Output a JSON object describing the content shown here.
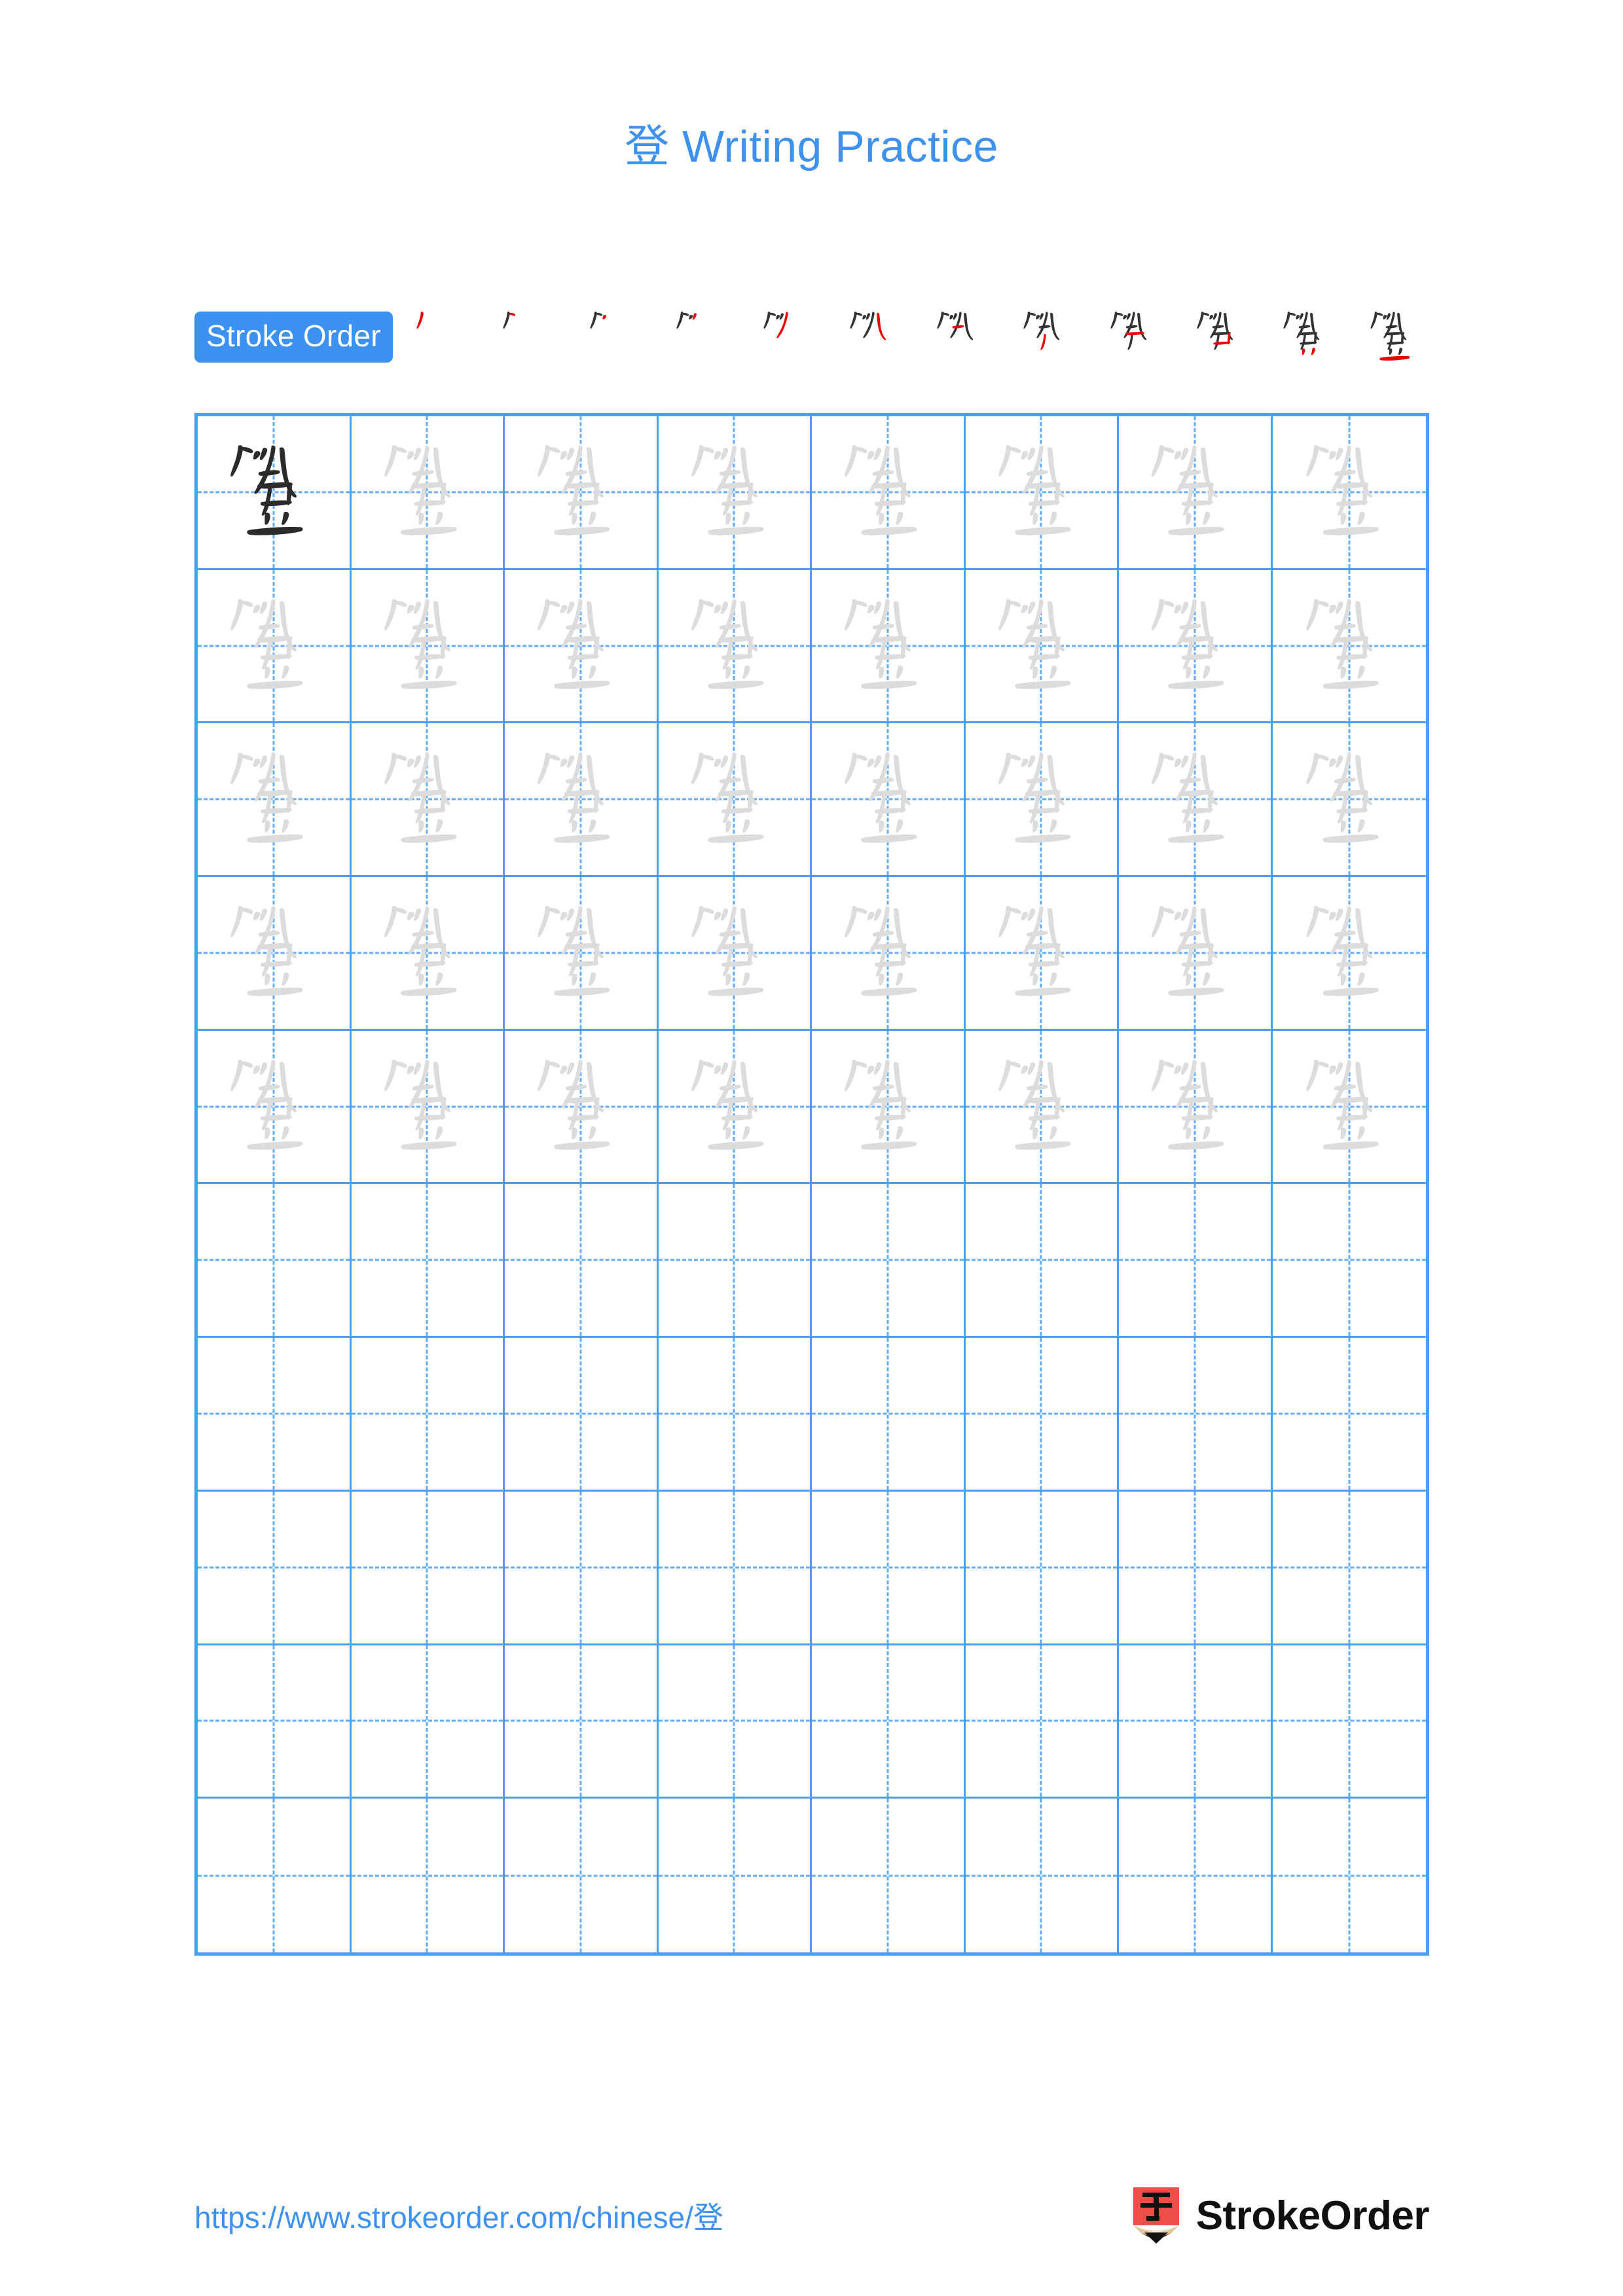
{
  "document": {
    "title_character": "登",
    "title_text": "Writing Practice",
    "title_full": "登 Writing Practice",
    "accent_color": "#3d91f0",
    "grid_line_color": "#4a9ff5",
    "guide_char_color": "#dcdcdc",
    "model_char_color": "#2b2b2b",
    "new_stroke_color": "#ee0000",
    "existing_stroke_color": "#333333"
  },
  "stroke_order": {
    "badge_label": "Stroke Order",
    "total_strokes": 12,
    "steps": [
      {
        "index": 1,
        "strokes_shown": 1
      },
      {
        "index": 2,
        "strokes_shown": 2
      },
      {
        "index": 3,
        "strokes_shown": 3
      },
      {
        "index": 4,
        "strokes_shown": 4
      },
      {
        "index": 5,
        "strokes_shown": 5
      },
      {
        "index": 6,
        "strokes_shown": 6
      },
      {
        "index": 7,
        "strokes_shown": 7
      },
      {
        "index": 8,
        "strokes_shown": 8
      },
      {
        "index": 9,
        "strokes_shown": 9
      },
      {
        "index": 10,
        "strokes_shown": 10
      },
      {
        "index": 11,
        "strokes_shown": 11
      },
      {
        "index": 12,
        "strokes_shown": 12
      }
    ]
  },
  "practice_grid": {
    "columns": 8,
    "rows": 10,
    "character": "登",
    "rows_with_characters": 5,
    "rows_empty": 5,
    "cells": [
      [
        "model",
        "guide",
        "guide",
        "guide",
        "guide",
        "guide",
        "guide",
        "guide"
      ],
      [
        "guide",
        "guide",
        "guide",
        "guide",
        "guide",
        "guide",
        "guide",
        "guide"
      ],
      [
        "guide",
        "guide",
        "guide",
        "guide",
        "guide",
        "guide",
        "guide",
        "guide"
      ],
      [
        "guide",
        "guide",
        "guide",
        "guide",
        "guide",
        "guide",
        "guide",
        "guide"
      ],
      [
        "guide",
        "guide",
        "guide",
        "guide",
        "guide",
        "guide",
        "guide",
        "guide"
      ],
      [
        "empty",
        "empty",
        "empty",
        "empty",
        "empty",
        "empty",
        "empty",
        "empty"
      ],
      [
        "empty",
        "empty",
        "empty",
        "empty",
        "empty",
        "empty",
        "empty",
        "empty"
      ],
      [
        "empty",
        "empty",
        "empty",
        "empty",
        "empty",
        "empty",
        "empty",
        "empty"
      ],
      [
        "empty",
        "empty",
        "empty",
        "empty",
        "empty",
        "empty",
        "empty",
        "empty"
      ],
      [
        "empty",
        "empty",
        "empty",
        "empty",
        "empty",
        "empty",
        "empty",
        "empty"
      ]
    ]
  },
  "footer": {
    "url": "https://www.strokeorder.com/chinese/登",
    "brand_name": "StrokeOrder",
    "logo_character": "字",
    "logo_body_color": "#ee4e49",
    "logo_wood_color": "#e3c295",
    "logo_tip_color": "#111111"
  }
}
